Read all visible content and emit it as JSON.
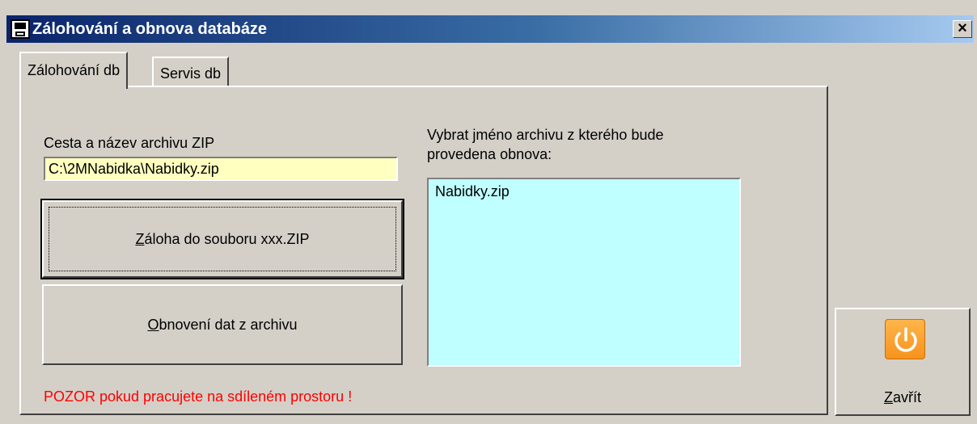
{
  "window": {
    "title": "Zálohování a obnova databáze",
    "close_glyph": "×"
  },
  "tabs": [
    {
      "label": "Zálohování db",
      "active": true
    },
    {
      "label": "Servis db",
      "active": false
    }
  ],
  "backup": {
    "path_label": "Cesta a název archivu ZIP",
    "path_value": "C:\\2MNabidka\\Nabidky.zip",
    "backup_button": {
      "mnemonic": "Z",
      "rest": "áloha do souboru xxx.ZIP"
    },
    "restore_button": {
      "mnemonic": "O",
      "rest": "bnovení dat z archivu"
    },
    "warning": "POZOR pokud pracujete na sdíleném prostoru !"
  },
  "restore": {
    "list_label_line1": "Vybrat jméno archivu z kterého bude",
    "list_label_line2": "provedena obnova:",
    "archives": [
      "Nabidky.zip"
    ]
  },
  "close_button": {
    "mnemonic": "Z",
    "rest": "avřít",
    "icon": "power-icon"
  },
  "colors": {
    "path_input_bg": "#ffffc0",
    "archive_list_bg": "#c0ffff",
    "warning_text": "#ff0000",
    "power_icon": "#f7931e"
  }
}
